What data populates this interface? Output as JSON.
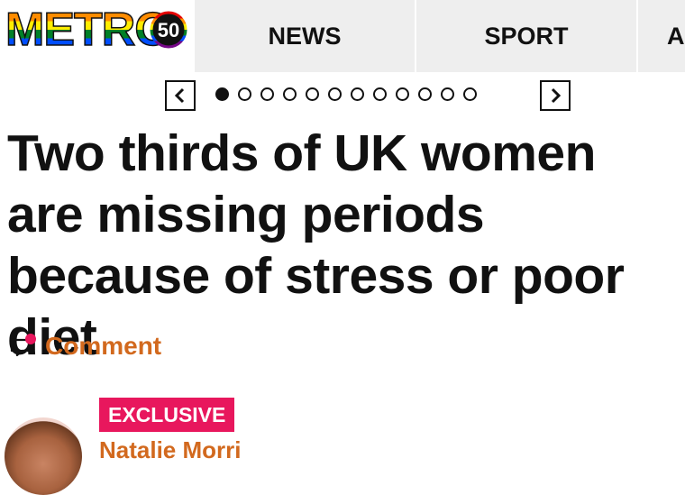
{
  "header": {
    "logo_text": "METRO",
    "logo_badge": "50",
    "nav": [
      {
        "label": "NEWS"
      },
      {
        "label": "SPORT"
      },
      {
        "label": "A"
      }
    ]
  },
  "carousel": {
    "dot_count": 12,
    "active_index": 0
  },
  "article": {
    "headline": "Two thirds of UK women are missing periods because of stress or poor diet",
    "comment_label": "Comment",
    "badge": "EXCLUSIVE",
    "author": "Natalie Morri"
  },
  "colors": {
    "accent": "#d2691e",
    "badge": "#e8175d",
    "nav_bg": "#eeeeee",
    "text": "#111111"
  }
}
